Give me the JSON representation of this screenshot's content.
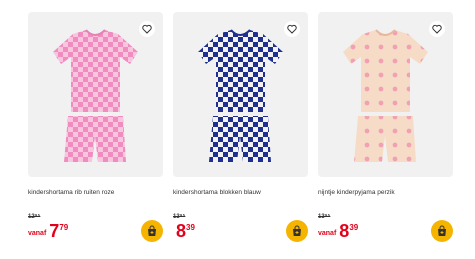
{
  "products": [
    {
      "title": "kindershortama rib ruiten roze",
      "old_price": "12⁹⁵",
      "prefix": "vanaf",
      "price_euros": "7",
      "price_cents": "79",
      "colors": {
        "a": "#f7a8d0",
        "b": "#f6e9ee"
      },
      "heart_icon": "heart-outline-icon",
      "cart_icon": "shopping-bag-icon"
    },
    {
      "title": "kindershortama blokken blauw",
      "old_price": "13⁹⁵",
      "prefix": "",
      "price_euros": "8",
      "price_cents": "39",
      "colors": {
        "a": "#1e2f8f",
        "b": "#f3f3f3"
      },
      "heart_icon": "heart-outline-icon",
      "cart_icon": "shopping-bag-icon"
    },
    {
      "title": "nijntje kinderpyjama perzik",
      "old_price": "13⁹⁵",
      "prefix": "vanaf",
      "price_euros": "8",
      "price_cents": "39",
      "colors": {
        "a": "#f6d9c2",
        "b": "#f2a0b4"
      },
      "heart_icon": "heart-outline-icon",
      "cart_icon": "shopping-bag-icon"
    }
  ],
  "theme": {
    "price_color": "#e3001b",
    "cart_color": "#f4b400"
  }
}
